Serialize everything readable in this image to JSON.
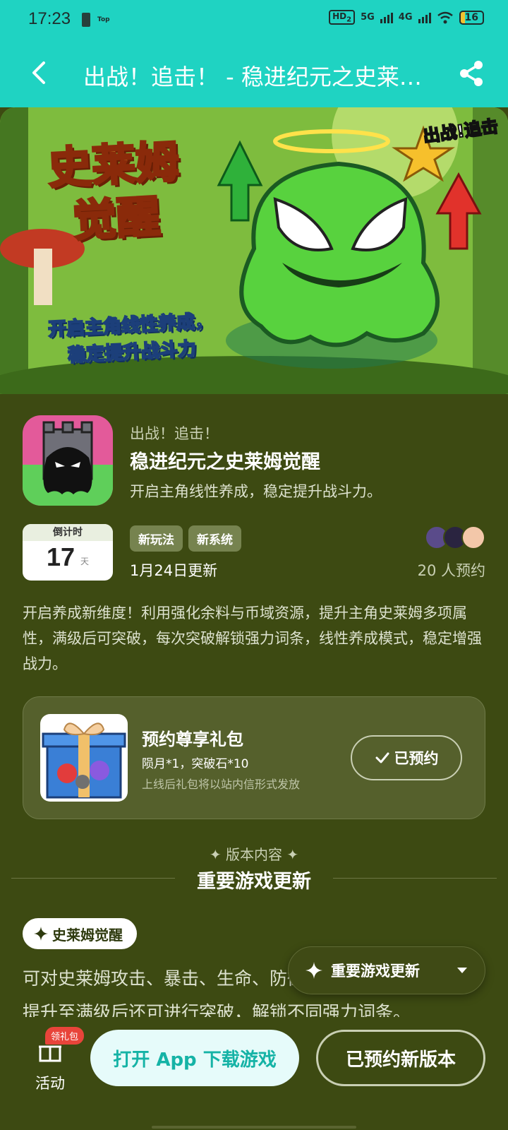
{
  "status_bar": {
    "time": "17:23",
    "small_label": "Top",
    "hd": "HD",
    "hd_sub": "2",
    "net1": "5G",
    "net2": "4G",
    "battery": "16"
  },
  "nav": {
    "title": "出战！追击！ - 稳进纪元之史莱姆觉醒",
    "back_icon": "chevron-left-icon",
    "share_icon": "share-icon"
  },
  "banner": {
    "title": "史莱姆觉醒",
    "subtitle_line1": "开启主角线性养成，",
    "subtitle_line2": "稳定提升战斗力",
    "badge": "出战!追击"
  },
  "app": {
    "category": "出战！追击！",
    "name": "稳进纪元之史莱姆觉醒",
    "tagline": "开启主角线性养成，稳定提升战斗力。",
    "countdown_label": "倒计时",
    "countdown_value": "17",
    "countdown_unit": "天",
    "tags": [
      "新玩法",
      "新系统"
    ],
    "update_date": "1月24日更新",
    "reserve_count": "20 人预约",
    "description": "开启养成新维度！利用强化余料与币域资源，提升主角史莱姆多项属性，满级后可突破，每次突破解锁强力词条，线性养成模式，稳定增强战力。"
  },
  "gift": {
    "title": "预约尊享礼包",
    "items": "陨月*1，突破石*10",
    "note": "上线后礼包将以站内信形式发放",
    "button": "已预约"
  },
  "version": {
    "kicker": "✦ 版本内容 ✦",
    "title": "重要游戏更新",
    "chip": "史莱姆觉醒",
    "body": "可对史莱姆攻击、暴击、生命、防御等属性进行强化，每次提升至满级后还可进行突破，解锁不同强力词条。",
    "dropdown": "重要游戏更新"
  },
  "bottom": {
    "activity_label": "活动",
    "gift_badge": "领礼包",
    "open_app": "打开 App 下载游戏",
    "reserved_new": "已预约新版本"
  },
  "colors": {
    "header": "#1fd3c2",
    "background": "#3d4a12",
    "card": "#55602c",
    "accent_teal": "#15b3a6"
  }
}
